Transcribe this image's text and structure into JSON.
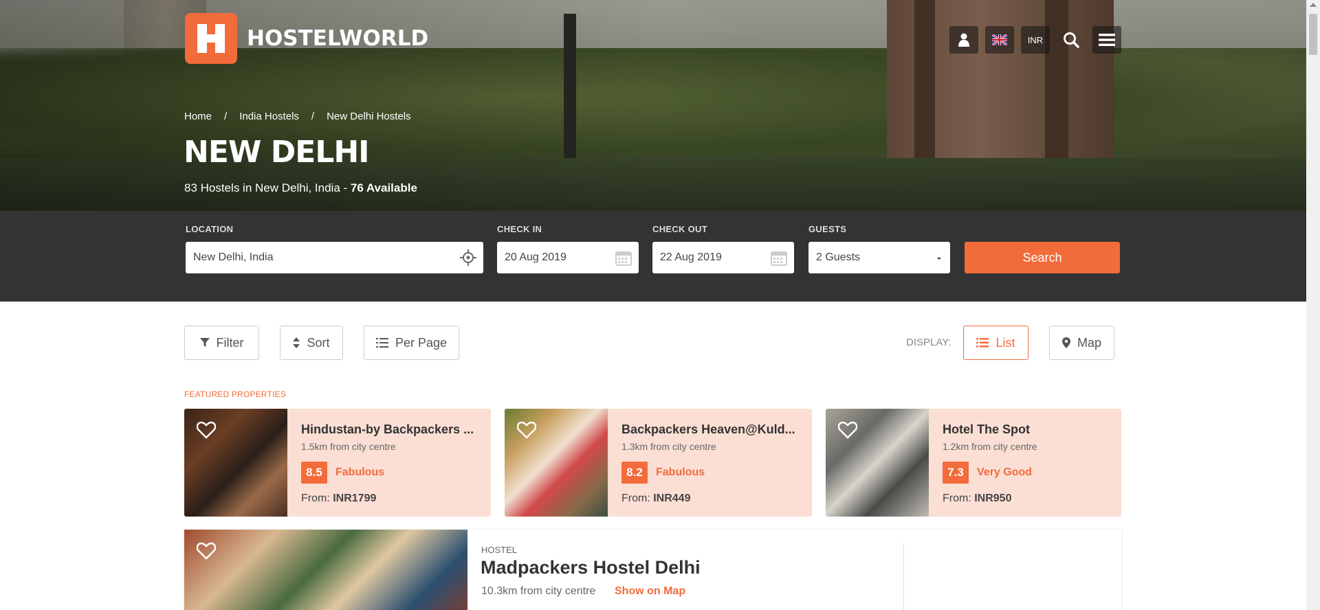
{
  "brand": {
    "name": "HOSTELWORLD",
    "accent": "#f26b3a"
  },
  "header": {
    "currency": "INR",
    "icons": [
      "user-icon",
      "uk-flag-icon",
      "currency-button",
      "search-icon",
      "menu-icon"
    ]
  },
  "breadcrumb": [
    "Home",
    "India Hostels",
    "New Delhi Hostels"
  ],
  "breadcrumb_sep": "/",
  "city": {
    "title": "NEW DELHI",
    "subtitle_prefix": "83 Hostels in New Delhi, India - ",
    "subtitle_available": "76 Available"
  },
  "search": {
    "location_label": "LOCATION",
    "location_value": "New Delhi, India",
    "checkin_label": "CHECK IN",
    "checkin_value": "20 Aug 2019",
    "checkout_label": "CHECK OUT",
    "checkout_value": "22 Aug 2019",
    "guests_label": "GUESTS",
    "guests_value": "2 Guests",
    "button": "Search"
  },
  "toolbar": {
    "filter": "Filter",
    "sort": "Sort",
    "per_page": "Per Page",
    "display_label": "DISPLAY:",
    "list": "List",
    "map": "Map"
  },
  "featured": {
    "label": "FEATURED PROPERTIES",
    "items": [
      {
        "name": "Hindustan-by Backpackers ...",
        "distance": "1.5km from city centre",
        "score": "8.5",
        "rating": "Fabulous",
        "price_prefix": "From: ",
        "price": "INR1799"
      },
      {
        "name": "Backpackers Heaven@Kuld...",
        "distance": "1.3km from city centre",
        "score": "8.2",
        "rating": "Fabulous",
        "price_prefix": "From: ",
        "price": "INR449"
      },
      {
        "name": "Hotel The Spot",
        "distance": "1.2km from city centre",
        "score": "7.3",
        "rating": "Very Good",
        "price_prefix": "From: ",
        "price": "INR950"
      }
    ]
  },
  "listing": {
    "type": "HOSTEL",
    "name": "Madpackers Hostel Delhi",
    "distance": "10.3km from city centre",
    "map_link": "Show on Map"
  }
}
